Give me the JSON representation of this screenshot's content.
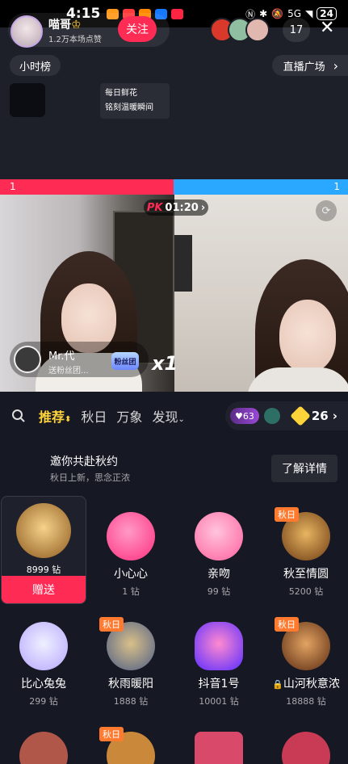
{
  "status_bar": {
    "time": "4:15",
    "network": "5G",
    "battery": "24",
    "app_icon_colors": [
      "#ff9a1a",
      "#ff3b3b",
      "#ff8a00",
      "#1677ff",
      "#ff2442"
    ]
  },
  "host": {
    "name": "喵哥",
    "likes": "1.2万本场点赞",
    "follow_label": "关注"
  },
  "viewers": {
    "count": "17",
    "close_icon": "✕",
    "avatar_colors": [
      "#d9392b",
      "#8fbfa0",
      "#e0b8b0"
    ]
  },
  "hour_rank_label": "小时榜",
  "live_square_label": "直播广场",
  "live_square_arrow": "›",
  "flower_card": {
    "line1": "每日鲜花",
    "line2": "铭刻温暖瞬间"
  },
  "pk": {
    "left_score": "1",
    "right_score": "1",
    "timer_label": "PK",
    "timer": "01:20",
    "timer_arrow": "›",
    "colors": {
      "left": "#fe2c55",
      "right": "#2aa7ff"
    }
  },
  "gift_notice": {
    "sender": "Mr.代",
    "action": "送粉丝团...",
    "badge": "粉丝团",
    "combo": "x1"
  },
  "share_icon": "⟳",
  "gift_tabs": {
    "active": "推荐",
    "active_arrow": "⬍",
    "items": [
      "秋日",
      "万象",
      "发现"
    ],
    "dropdown_arrow": "⌄",
    "level": "63",
    "coins": "26",
    "coins_arrow": "›"
  },
  "banner": {
    "title": "邀你共赴秋约",
    "subtitle": "秋日上新，思念正浓",
    "detail_label": "了解详情"
  },
  "gifts": [
    {
      "name": "",
      "price": "8999 钻",
      "tag": "",
      "send": "赠送",
      "color": "#b8742a"
    },
    {
      "name": "小心心",
      "price": "1 钻",
      "tag": "",
      "color": "#ff3d8b"
    },
    {
      "name": "亲吻",
      "price": "99 钻",
      "tag": "",
      "color": "#ff6aa8"
    },
    {
      "name": "秋至情圆",
      "price": "5200 钻",
      "tag": "秋日",
      "color": "#a35b1c"
    },
    {
      "name": "比心兔兔",
      "price": "299 钻",
      "tag": "",
      "color": "#c9b8ff"
    },
    {
      "name": "秋雨暖阳",
      "price": "1888 钻",
      "tag": "秋日",
      "color": "#6d7fa8"
    },
    {
      "name": "抖音1号",
      "price": "10001 钻",
      "tag": "",
      "color": "#7a4cff"
    },
    {
      "name": "山河秋意浓",
      "price": "18888 钻",
      "tag": "秋日",
      "color": "#b35b22",
      "locked": true
    }
  ],
  "row3_tag": "秋日",
  "row3_colors": [
    "#b0574a",
    "#c9883a",
    "#d94a6a",
    "#c93a55"
  ],
  "lock_icon": "🔒"
}
